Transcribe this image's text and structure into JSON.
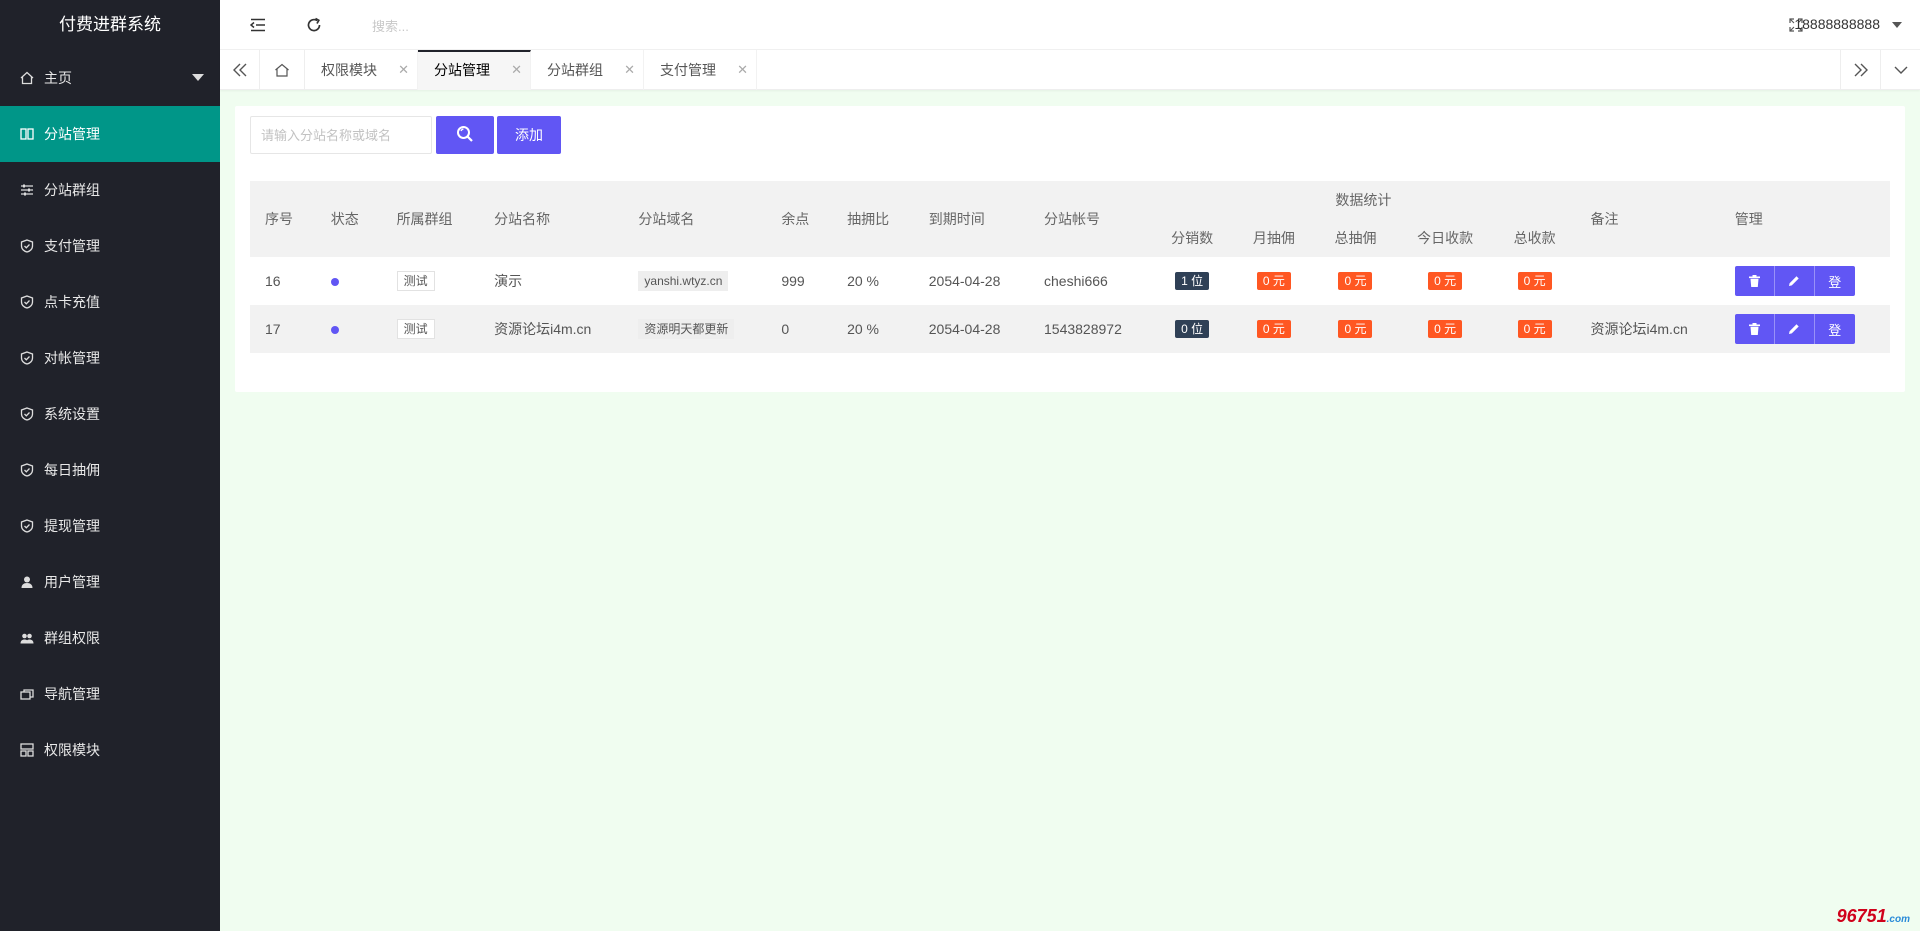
{
  "app": {
    "title": "付费进群系统"
  },
  "sidebar": {
    "items": [
      {
        "label": "主页",
        "icon": "home-icon"
      },
      {
        "label": "分站管理",
        "icon": "columns-icon"
      },
      {
        "label": "分站群组",
        "icon": "sliders-icon"
      },
      {
        "label": "支付管理",
        "icon": "shield-icon"
      },
      {
        "label": "点卡充值",
        "icon": "shield-icon"
      },
      {
        "label": "对帐管理",
        "icon": "shield-icon"
      },
      {
        "label": "系统设置",
        "icon": "shield-icon"
      },
      {
        "label": "每日抽佣",
        "icon": "shield-icon"
      },
      {
        "label": "提现管理",
        "icon": "shield-icon"
      },
      {
        "label": "用户管理",
        "icon": "user-icon"
      },
      {
        "label": "群组权限",
        "icon": "users-icon"
      },
      {
        "label": "导航管理",
        "icon": "nav-icon"
      },
      {
        "label": "权限模块",
        "icon": "grid-icon"
      }
    ]
  },
  "header": {
    "search_placeholder": "搜索...",
    "username": "18888888888"
  },
  "tabs": [
    {
      "label": "权限模块"
    },
    {
      "label": "分站管理",
      "active": true
    },
    {
      "label": "分站群组"
    },
    {
      "label": "支付管理"
    }
  ],
  "toolbar": {
    "search_placeholder": "请输入分站名称或域名",
    "add_label": "添加"
  },
  "table": {
    "headers": {
      "id": "序号",
      "status": "状态",
      "group": "所属群组",
      "name": "分站名称",
      "domain": "分站域名",
      "balance": "余点",
      "ratio": "抽拥比",
      "expire": "到期时间",
      "account": "分站帐号",
      "stats": "数据统计",
      "sales": "分销数",
      "monthly": "月抽佣",
      "total_comm": "总抽佣",
      "today": "今日收款",
      "total_recv": "总收款",
      "note": "备注",
      "manage": "管理"
    },
    "rows": [
      {
        "id": "16",
        "group": "测试",
        "name": "演示",
        "domain": "yanshi.wtyz.cn",
        "balance": "999",
        "ratio": "20 %",
        "expire": "2054-04-28",
        "account": "cheshi666",
        "sales": "1 位",
        "monthly": "0 元",
        "total_comm": "0 元",
        "today": "0 元",
        "total_recv": "0 元",
        "note": "",
        "login": "登"
      },
      {
        "id": "17",
        "group": "测试",
        "name": "资源论坛i4m.cn",
        "domain": "资源明天都更新",
        "balance": "0",
        "ratio": "20 %",
        "expire": "2054-04-28",
        "account": "1543828972",
        "sales": "0 位",
        "monthly": "0 元",
        "total_comm": "0 元",
        "today": "0 元",
        "total_recv": "0 元",
        "note": "资源论坛i4m.cn",
        "login": "登"
      }
    ]
  },
  "colors": {
    "sidebar": "#20222a",
    "active": "#009688",
    "primary": "#6156f4",
    "orange": "#ff5722",
    "dark_badge": "#2f4056"
  },
  "watermark": {
    "main": "96751",
    "sub": ".com"
  }
}
